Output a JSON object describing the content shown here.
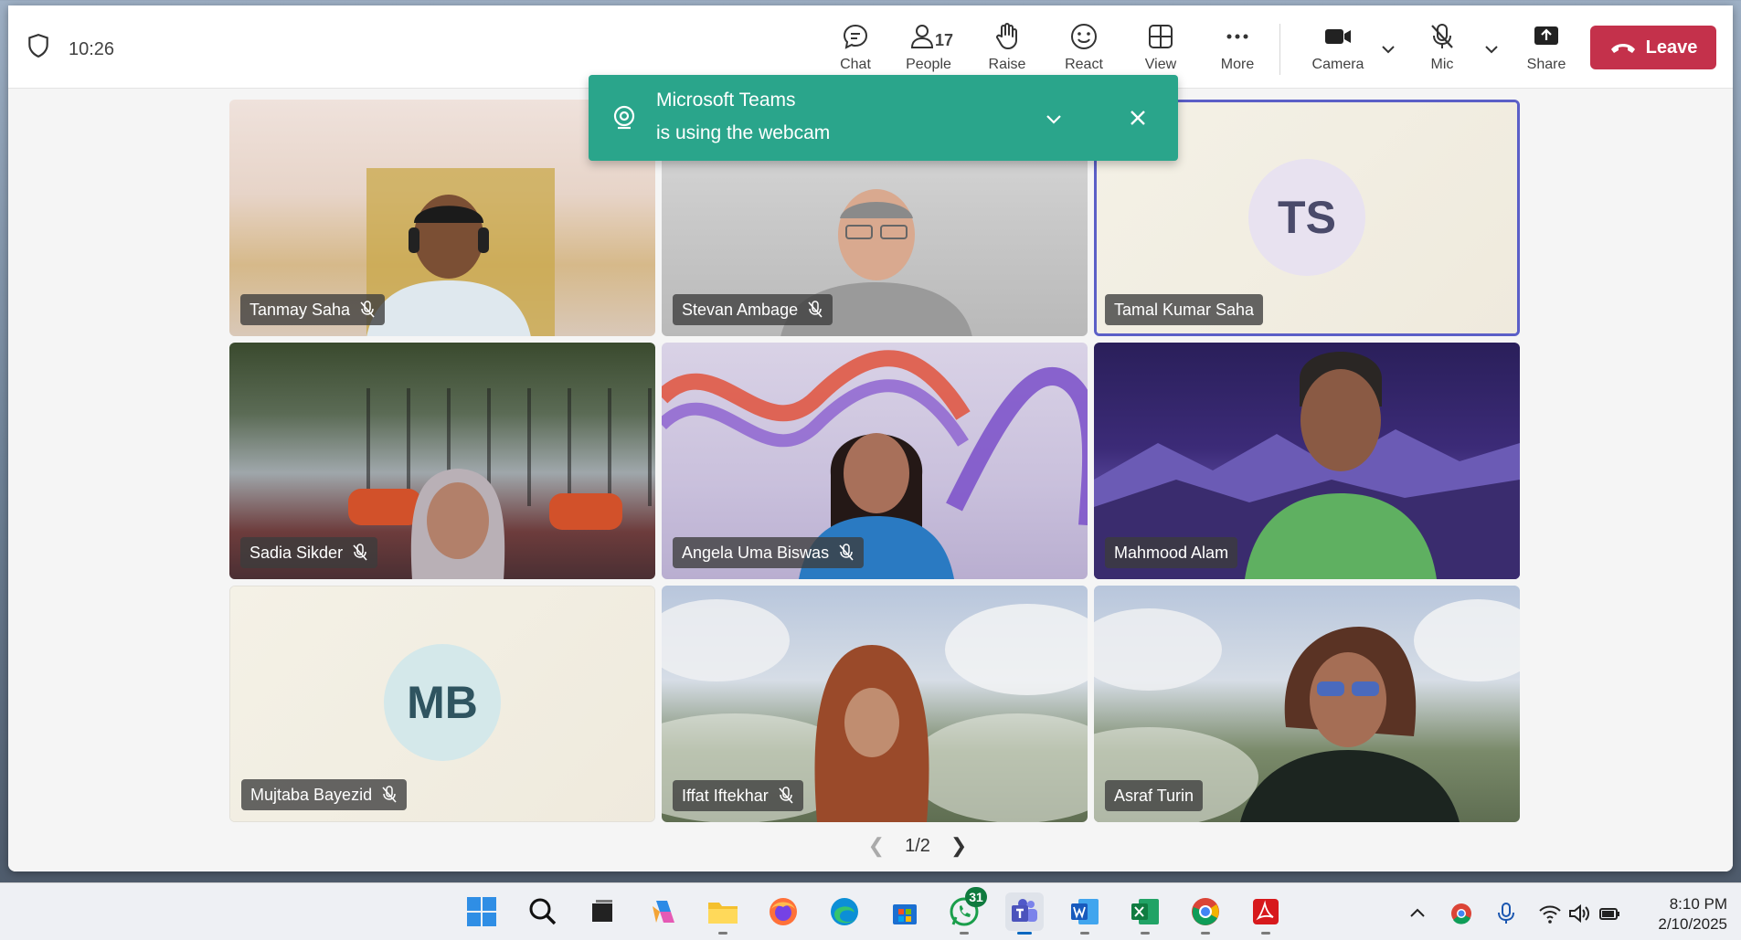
{
  "meeting": {
    "timer": "10:26",
    "toolbar": {
      "chat_label": "Chat",
      "people_label": "People",
      "people_count": "17",
      "raise_label": "Raise",
      "react_label": "React",
      "view_label": "View",
      "more_label": "More",
      "camera_label": "Camera",
      "mic_label": "Mic",
      "share_label": "Share",
      "leave_label": "Leave"
    },
    "participants": [
      {
        "name": "Tanmay Saha",
        "muted": true
      },
      {
        "name": "Stevan Ambage",
        "muted": true
      },
      {
        "name": "Tamal Kumar Saha",
        "muted": false,
        "initials": "TS"
      },
      {
        "name": "Sadia Sikder",
        "muted": true
      },
      {
        "name": "Angela Uma Biswas",
        "muted": true
      },
      {
        "name": "Mahmood Alam",
        "muted": false
      },
      {
        "name": "Mujtaba Bayezid",
        "muted": true,
        "initials": "MB"
      },
      {
        "name": "Iffat Iftekhar",
        "muted": true
      },
      {
        "name": "Asraf Turin",
        "muted": false
      }
    ],
    "pager": "1/2"
  },
  "toast": {
    "line1": "Microsoft Teams",
    "line2": "is using the webcam"
  },
  "taskbar": {
    "whatsapp_badge": "31",
    "clock_time": "8:10 PM",
    "clock_date": "2/10/2025"
  },
  "colors": {
    "leave": "#c4314b",
    "toast": "#2aa58b",
    "active_speaker_border": "#5b5fc7"
  }
}
